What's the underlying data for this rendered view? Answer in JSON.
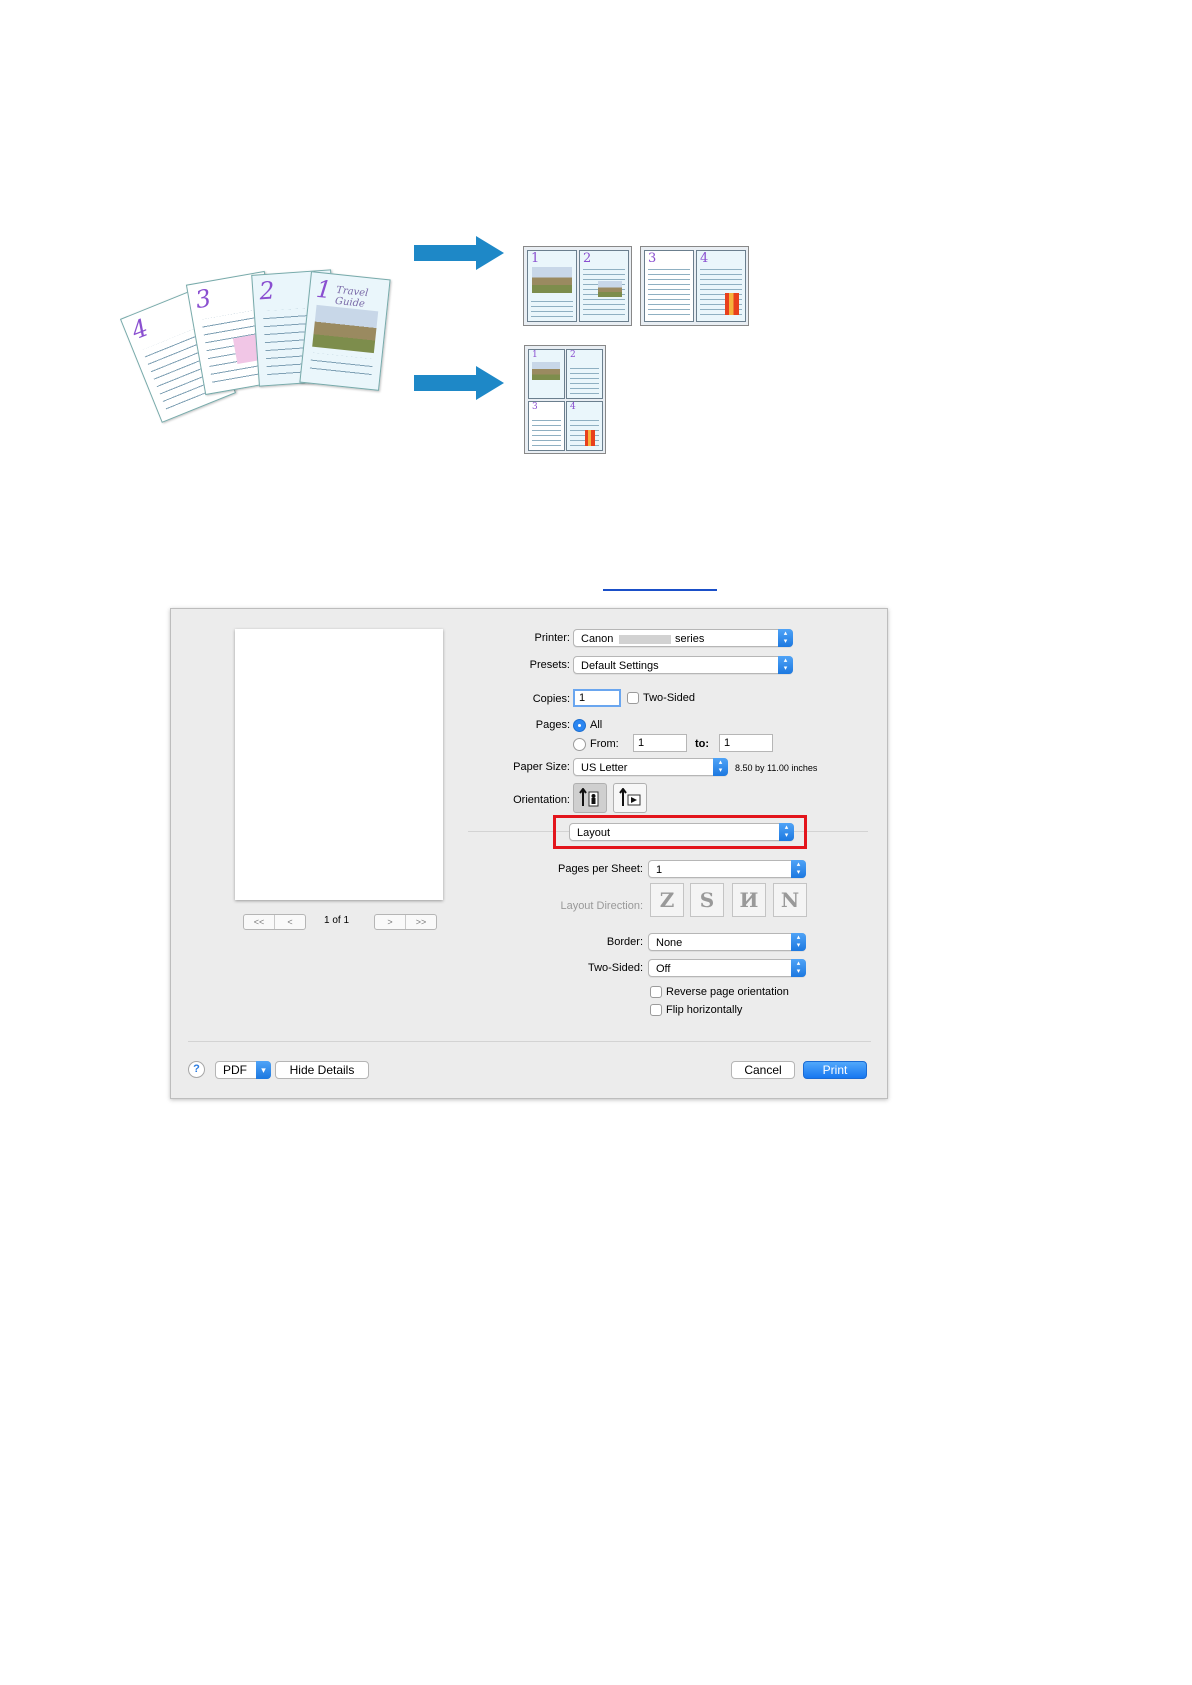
{
  "illustration": {
    "source_page_numbers": [
      "4",
      "3",
      "2",
      "1"
    ],
    "cover_title": "Travel Guide",
    "two_up_numbers": [
      "1",
      "2",
      "3",
      "4"
    ],
    "four_up_numbers": [
      "1",
      "2",
      "3",
      "4"
    ],
    "arrow_color": "#1e88c7"
  },
  "dialog": {
    "printer_label": "Printer:",
    "printer_value_prefix": "Canon",
    "printer_value_suffix": "series",
    "presets_label": "Presets:",
    "presets_value": "Default Settings",
    "copies_label": "Copies:",
    "copies_value": "1",
    "two_sided_check_label": "Two-Sided",
    "pages_label": "Pages:",
    "pages_all_label": "All",
    "pages_from_label": "From:",
    "pages_from_value": "1",
    "pages_to_label": "to:",
    "pages_to_value": "1",
    "paper_size_label": "Paper Size:",
    "paper_size_value": "US Letter",
    "paper_size_dims": "8.50 by 11.00 inches",
    "orientation_label": "Orientation:",
    "panel_value": "Layout",
    "pages_per_sheet_label": "Pages per Sheet:",
    "pages_per_sheet_value": "1",
    "layout_direction_label": "Layout Direction:",
    "layout_direction_glyphs": [
      "Z",
      "S",
      "И",
      "N"
    ],
    "border_label": "Border:",
    "border_value": "None",
    "two_sided_label": "Two-Sided:",
    "two_sided_value": "Off",
    "reverse_orientation_label": "Reverse page orientation",
    "flip_horizontally_label": "Flip horizontally",
    "page_indicator": "1 of 1",
    "pager": {
      "first": "<<",
      "prev": "<",
      "next": ">",
      "last": ">>"
    },
    "help_label": "?",
    "pdf_label": "PDF",
    "hide_details_label": "Hide Details",
    "cancel_label": "Cancel",
    "print_label": "Print",
    "highlight_color": "#e3151c",
    "accent_color": "#1c78e0"
  }
}
